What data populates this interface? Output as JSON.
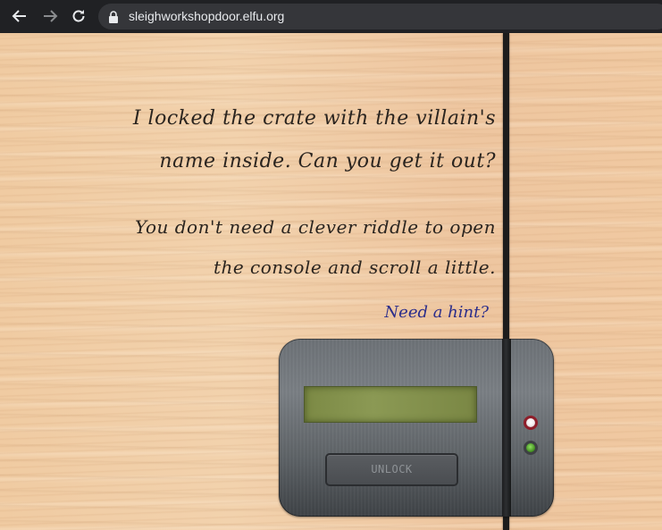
{
  "browser": {
    "url": "sleighworkshopdoor.elfu.org",
    "icons": {
      "back": "arrow-left-icon",
      "forward": "arrow-right-icon",
      "reload": "reload-icon",
      "secure": "lock-icon"
    }
  },
  "door": {
    "message_lines": [
      "I locked the crate with the villain's",
      "name inside. Can you get it out?",
      "You don't need a clever riddle to open",
      "the console and scroll a little."
    ],
    "hint_link": "Need a hint?",
    "unlock_button_label": "UNLOCK"
  },
  "colors": {
    "hint_link": "#2c2e8b",
    "display": "#8b9954",
    "led_red_ring": "#8e1e2a",
    "led_green": "#3f8a1f"
  }
}
